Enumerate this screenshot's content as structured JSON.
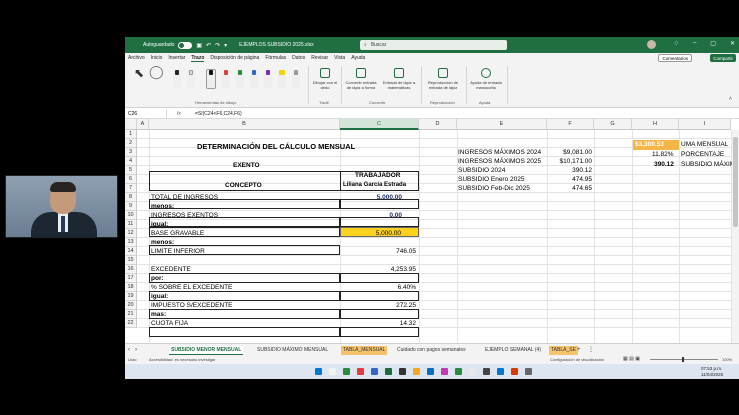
{
  "titlebar": {
    "autosave_label": "Autoguardado",
    "filename": "EJEMPLOS SUBSIDIO 2025.xlsx",
    "search_placeholder": "Buscar"
  },
  "menu": [
    "Archivo",
    "Inicio",
    "Insertar",
    "Trazo",
    "Disposición de página",
    "Fórmulas",
    "Datos",
    "Revisar",
    "Vista",
    "Ayuda"
  ],
  "active_menu": "Trazo",
  "buttons": {
    "comments": "Comentarios",
    "share": "Compartir"
  },
  "ribbon": {
    "group_drawing_tools": "Herramientas de dibujo",
    "draw_with_finger": "Dibujar con el dedo",
    "group_touch": "Táctil",
    "ink_to_shape": "Convertir entrada de lápiz a forma",
    "ink_to_math": "Entrada de lápiz a matemáticas",
    "group_convert": "Convertir",
    "ink_replay": "Reproducción de entrada de lápiz",
    "group_replay": "Reproducción",
    "ink_help": "Ayuda de entrada manuscrita",
    "group_help": "Ayuda",
    "pen_colors": [
      "#222222",
      "#e0e0e0",
      "#111111",
      "#e33b3b",
      "#2a8a3e",
      "#3466c9",
      "#7a2fb5",
      "#f5d300"
    ]
  },
  "formula_bar": {
    "cell_ref": "C26",
    "formula": "=SI(C24<F6,C24,F6)"
  },
  "columns": [
    "A",
    "B",
    "C",
    "D",
    "E",
    "F",
    "G",
    "H",
    "I"
  ],
  "selected_column": "C",
  "rows": [
    "1",
    "2",
    "3",
    "4",
    "5",
    "6",
    "7",
    "8",
    "9",
    "10",
    "11",
    "12",
    "13",
    "14",
    "15",
    "16",
    "17",
    "18",
    "19",
    "20",
    "21",
    "22"
  ],
  "sheet": {
    "title": "DETERMINACIÓN DEL CÁLCULO MENSUAL",
    "exento": "EXENTO",
    "trabajador": "TRABAJADOR",
    "concepto": "CONCEPTO",
    "nombre": "Liliana García Estrada",
    "lines": [
      {
        "label": "TOTAL DE INGRESOS",
        "value": "5,000.00"
      },
      {
        "label": "menos:",
        "value": ""
      },
      {
        "label": "INGRESOS EXENTOS",
        "value": "0.00"
      },
      {
        "label": "igual:",
        "value": ""
      },
      {
        "label": "BASE GRAVABLE",
        "value": "5,000.00"
      },
      {
        "label": "menos:",
        "value": ""
      },
      {
        "label": "LIMITE INFERIOR",
        "value": "746.05"
      },
      {
        "label": "",
        "value": ""
      },
      {
        "label": "EXCEDENTE",
        "value": "4,253.95"
      },
      {
        "label": "por:",
        "value": ""
      },
      {
        "label": "% SOBRE EL EXCEDENTE",
        "value": "6.40%"
      },
      {
        "label": "igual:",
        "value": ""
      },
      {
        "label": "IMPUESTO S/EXCEDENTE",
        "value": "272.25"
      },
      {
        "label": "mas:",
        "value": ""
      },
      {
        "label": "CUOTA FIJA",
        "value": "14.32"
      }
    ],
    "side_table": [
      {
        "label": "INGRESOS MÁXIMOS 2024",
        "value": "$9,081.00"
      },
      {
        "label": "INGRESOS MÁXIMOS 2025",
        "value": "$10,171.00"
      },
      {
        "label": "SUBSIDIO 2024",
        "value": "390.12"
      },
      {
        "label": "SUBSIDIO Enero 2025",
        "value": "474.95"
      },
      {
        "label": "SUBSIDIO Feb-Dic 2025",
        "value": "474.65"
      }
    ],
    "uma": {
      "value": "$3,300.53",
      "label": "UMA MENSUAL"
    },
    "porcentaje": {
      "value": "11.82%",
      "label": "PORCENTAJE"
    },
    "subsidio_max": {
      "value": "390.12",
      "label": "SUBSIDIO MÁXIMO"
    }
  },
  "sheet_tabs": [
    "SUBSIDIO MENOR MENSUAL",
    "SUBSIDIO MÁXIMO MENSUAL",
    "TABLA_MENSUAL",
    "Cuidado con pagos semanales",
    "EJEMPLO SEMANAL (4)",
    "TABLA_SE"
  ],
  "active_sheet": "SUBSIDIO MENOR MENSUAL",
  "status": {
    "ready": "Listo",
    "accessibility": "Accesibilidad: es necesario investigar",
    "display_settings": "Configuración de visualización",
    "zoom": "100%"
  },
  "clock": {
    "time": "07:53 p.m.",
    "date": "11/04/2025"
  }
}
